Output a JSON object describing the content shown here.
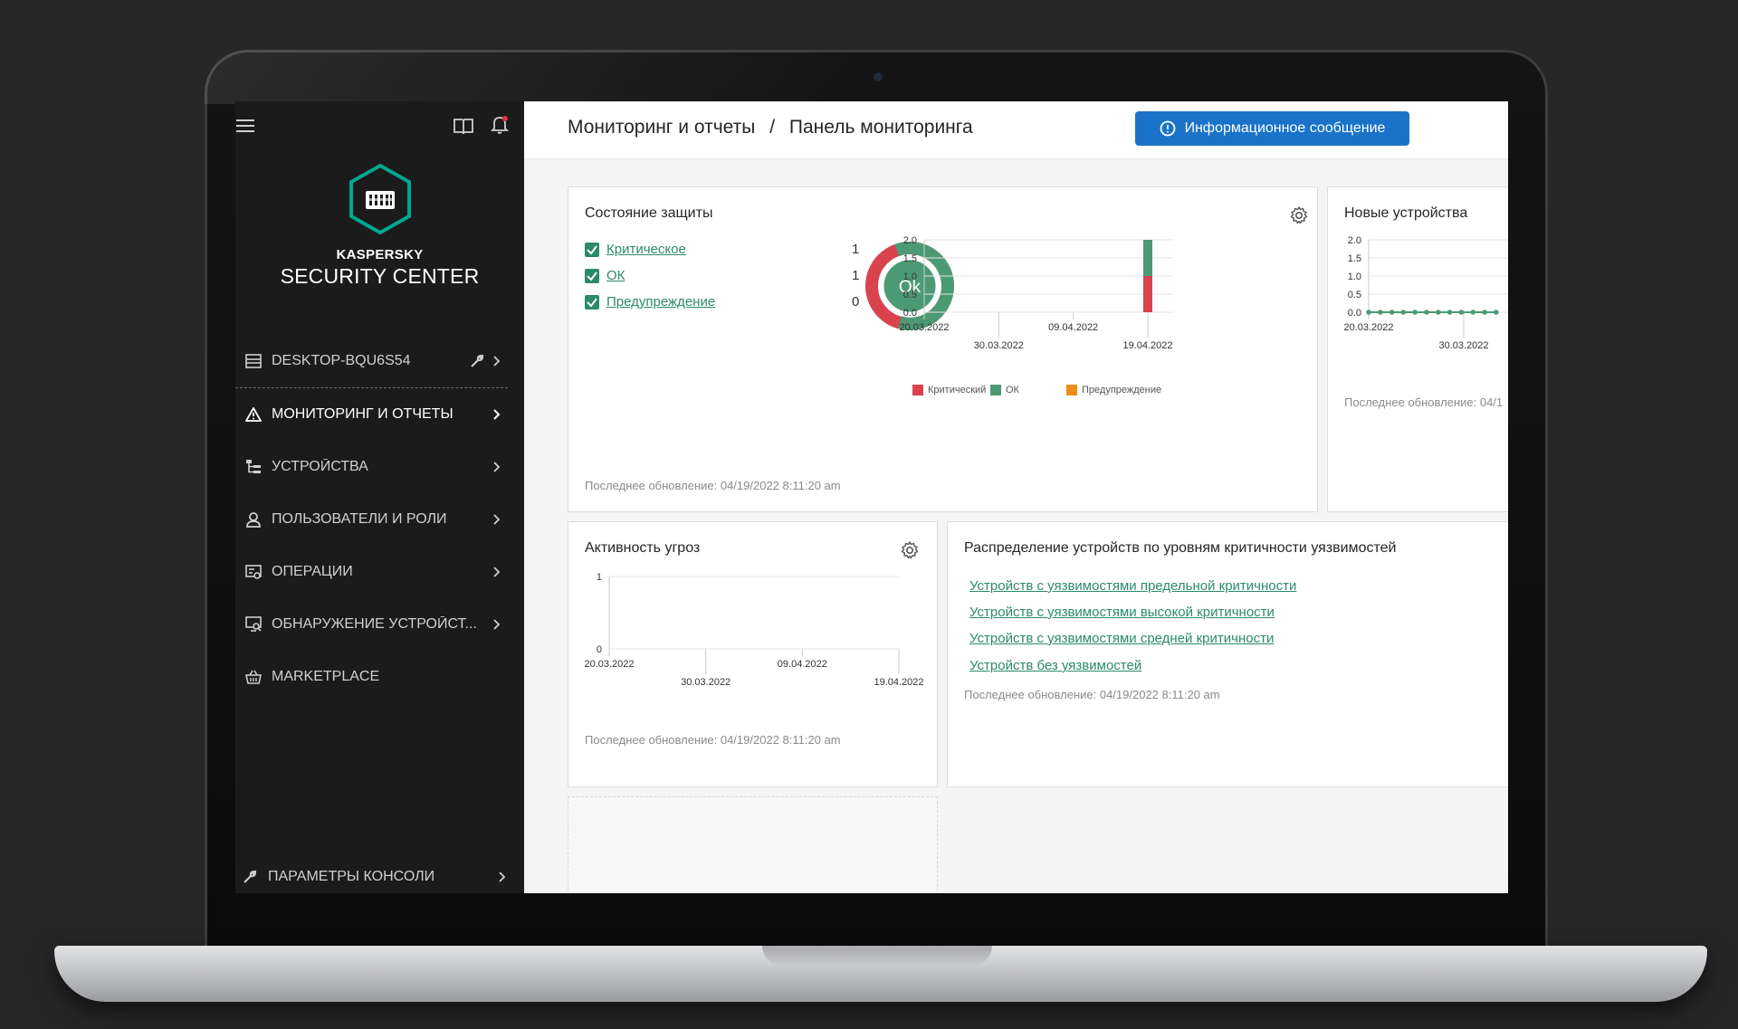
{
  "sidebar": {
    "brand": "KASPERSKY",
    "product": "SECURITY CENTER",
    "server": "DESKTOP-BQU6S54",
    "items": [
      {
        "label": "МОНИТОРИНГ И ОТЧЕТЫ",
        "icon": "warning-icon"
      },
      {
        "label": "УСТРОЙСТВА",
        "icon": "devices-tree-icon"
      },
      {
        "label": "ПОЛЬЗОВАТЕЛИ И РОЛИ",
        "icon": "user-icon"
      },
      {
        "label": "ОПЕРАЦИИ",
        "icon": "operations-icon"
      },
      {
        "label": "ОБНАРУЖЕНИЕ УСТРОЙСТ...",
        "icon": "discovery-icon"
      },
      {
        "label": "MARKETPLACE",
        "icon": "basket-icon"
      }
    ],
    "console_settings": "ПАРАМЕТРЫ КОНСОЛИ"
  },
  "header": {
    "breadcrumb_parent": "Мониторинг и отчеты",
    "breadcrumb_sep": "/",
    "breadcrumb_current": "Панель мониторинга",
    "info_button": "Информационное сообщение"
  },
  "protection": {
    "title": "Состояние защиты",
    "rows": [
      {
        "label": "Критическое",
        "count": "1"
      },
      {
        "label": "ОК",
        "count": "1"
      },
      {
        "label": "Предупреждение",
        "count": "0"
      }
    ],
    "donut_label": "Ok",
    "legend": [
      "Критический",
      "ОК",
      "Предупреждение"
    ],
    "updated": "Последнее обновление: 04/19/2022 8:11:20 am"
  },
  "new_devices": {
    "title": "Новые устройства",
    "updated": "Последнее обновление: 04/1"
  },
  "threats": {
    "title": "Активность угроз",
    "updated": "Последнее обновление: 04/19/2022 8:11:20 am"
  },
  "vuln": {
    "title": "Распределение устройств по уровням критичности уязвимостей",
    "links": [
      "Устройств с уязвимостями предельной критичности",
      "Устройств с уязвимостями высокой критичности",
      "Устройств с уязвимостями средней критичности",
      "Устройств без уязвимостей"
    ],
    "updated": "Последнее обновление: 04/19/2022 8:11:20 am"
  },
  "colors": {
    "critical": "#d9434e",
    "ok": "#4c9a74",
    "warning": "#f08c1c",
    "accent": "#1a73c8"
  },
  "chart_data": [
    {
      "type": "bar",
      "name": "protection-status",
      "x_ticks": [
        "20.03.2022",
        "30.03.2022",
        "09.04.2022",
        "19.04.2022"
      ],
      "ylim": [
        0,
        2.0
      ],
      "y_ticks": [
        "2.0",
        "1.5",
        "1.0",
        "0.5",
        "0.0"
      ],
      "series": [
        {
          "name": "Критический",
          "color": "#d9434e",
          "points": [
            {
              "x": "19.04.2022",
              "y": 1
            }
          ]
        },
        {
          "name": "ОК",
          "color": "#4c9a74",
          "points": [
            {
              "x": "19.04.2022",
              "y": 1
            }
          ]
        },
        {
          "name": "Предупреждение",
          "color": "#f08c1c",
          "points": []
        }
      ]
    },
    {
      "type": "line",
      "name": "new-devices",
      "x_ticks": [
        "20.03.2022",
        "30.03.2022"
      ],
      "ylim": [
        0,
        2.0
      ],
      "y_ticks": [
        "2.0",
        "1.5",
        "1.0",
        "0.5",
        "0.0"
      ],
      "series": [
        {
          "values": [
            0,
            0,
            0,
            0,
            0,
            0,
            0,
            0,
            0,
            0,
            0,
            0
          ]
        }
      ]
    },
    {
      "type": "line",
      "name": "threat-activity",
      "x_ticks": [
        "20.03.2022",
        "30.03.2022",
        "09.04.2022",
        "19.04.2022"
      ],
      "ylim": [
        0,
        1
      ],
      "y_ticks": [
        "1",
        "0"
      ]
    },
    {
      "type": "pie",
      "name": "protection-donut",
      "slices": [
        {
          "label": "ОК",
          "value": 1
        },
        {
          "label": "Критический",
          "value": 1
        }
      ]
    }
  ]
}
